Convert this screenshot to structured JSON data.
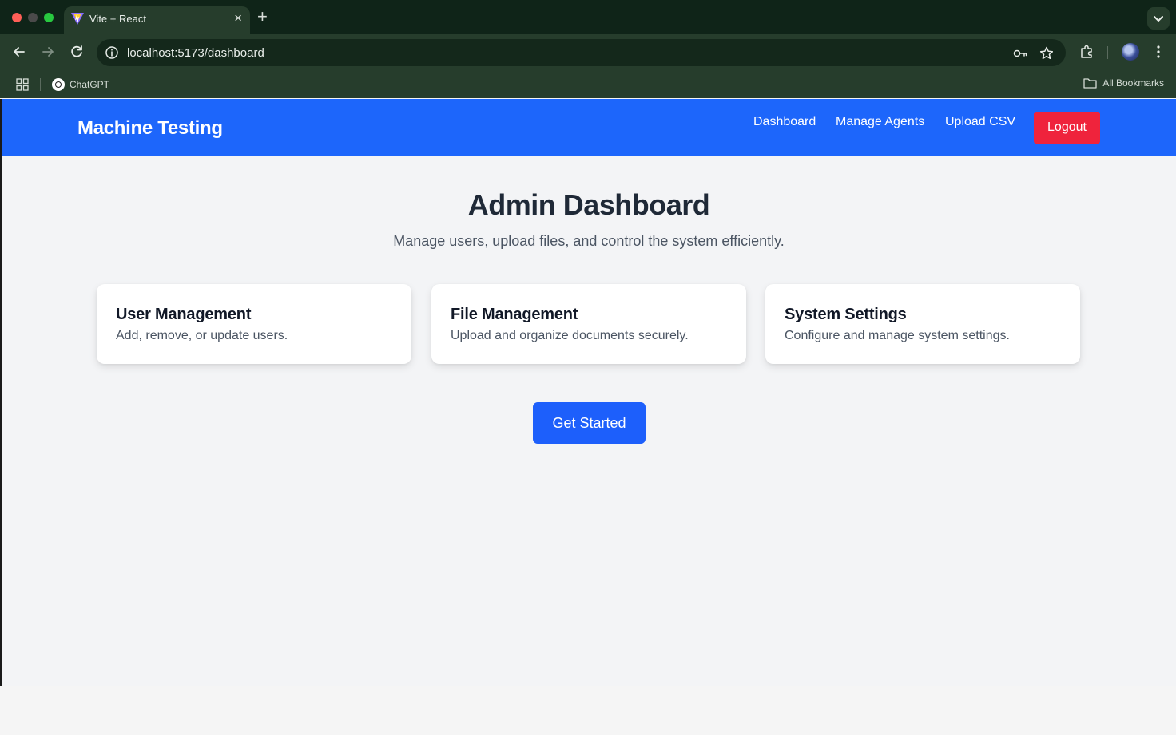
{
  "browser": {
    "tab": {
      "title": "Vite + React",
      "close": "×"
    },
    "new_tab": "+",
    "url": "localhost:5173/dashboard",
    "bookmarks": [
      {
        "label": "ChatGPT"
      }
    ],
    "all_bookmarks": "All Bookmarks"
  },
  "app": {
    "brand": "Machine Testing",
    "nav": {
      "dashboard": "Dashboard",
      "manage_agents": "Manage Agents",
      "upload_csv": "Upload CSV",
      "logout": "Logout"
    },
    "title": "Admin Dashboard",
    "subtitle": "Manage users, upload files, and control the system efficiently.",
    "cards": [
      {
        "title": "User Management",
        "description": "Add, remove, or update users."
      },
      {
        "title": "File Management",
        "description": "Upload and organize documents securely."
      },
      {
        "title": "System Settings",
        "description": "Configure and manage system settings."
      }
    ],
    "cta": "Get Started"
  },
  "colors": {
    "navbar": "#1d66fb",
    "logout": "#ef233c",
    "cta": "#1d5ffb",
    "background": "#f3f4f6"
  }
}
